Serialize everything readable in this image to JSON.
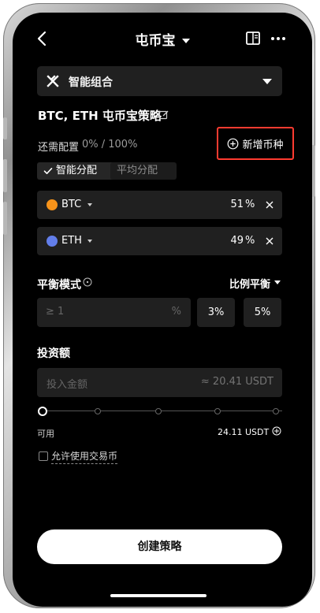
{
  "header": {
    "title": "屯币宝"
  },
  "portfolio": {
    "label": "智能组合"
  },
  "strategy": {
    "title": "BTC, ETH 屯币宝策略"
  },
  "allocation": {
    "need_label": "还需配置",
    "need_value": "0% / 100%",
    "add_coin_label": "新增币种",
    "modes": [
      {
        "label": "智能分配"
      },
      {
        "label": "平均分配"
      }
    ],
    "assets": [
      {
        "name": "BTC",
        "percent": "51",
        "unit": "%"
      },
      {
        "name": "ETH",
        "percent": "49",
        "unit": "%"
      }
    ]
  },
  "balance": {
    "label": "平衡模式",
    "mode": "比例平衡",
    "input_placeholder": "≥ 1",
    "input_unit": "%",
    "presets": [
      "3%",
      "5%"
    ]
  },
  "investment": {
    "label": "投资额",
    "placeholder": "投入金额",
    "approx": "≈ 20.41 USDT",
    "slider_value_fraction": 0,
    "available_label": "可用",
    "available_value": "24.11 USDT",
    "allow_label": "允许使用交易币"
  },
  "actions": {
    "create_label": "创建策略"
  },
  "colors": {
    "background": "#000000",
    "surface": "#202020",
    "highlight": "#ff3b30",
    "btc": "#f7931a",
    "eth": "#627eea"
  },
  "icons": {
    "back": "chevron-left-icon",
    "title_dropdown": "caret-down-icon",
    "book": "book-icon",
    "more": "more-icon",
    "portfolio": "grid-icon",
    "edit": "edit-icon",
    "add": "plus-circle-icon",
    "check": "check-icon",
    "remove": "close-icon",
    "info": "info-icon"
  }
}
